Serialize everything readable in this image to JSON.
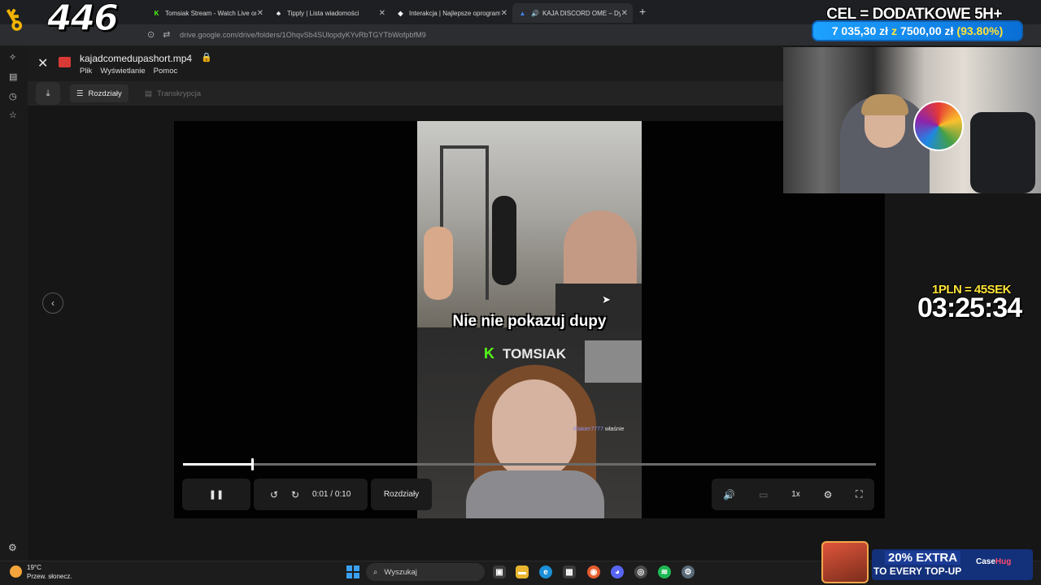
{
  "browser": {
    "tabs": [
      {
        "label": "Tomsiak Stream - Watch Live on",
        "favicon": "kick-icon",
        "color": "#53fc18"
      },
      {
        "label": "Tipply | Lista wiadomości",
        "favicon": "tipply-icon",
        "color": "#ffffff"
      },
      {
        "label": "Interakcja | Najlepsze oprogram",
        "favicon": "diamond-icon",
        "color": "#ffffff"
      },
      {
        "label": "KAJA DISCORD OME – Dysk",
        "favicon": "drive-icon",
        "color": "#4285f4"
      }
    ],
    "url": "drive.google.com/drive/folders/1OhqvSb4SUlopdyKYvRbTGYTbWofpbfM9"
  },
  "overlay": {
    "logo_number": "446",
    "goal_title": "CEL = DODATKOWE 5H+",
    "goal_current": "7 035,30 zł",
    "goal_separator": "z",
    "goal_target": "7500,00 zł",
    "goal_percent": "(93.80%)",
    "timer_rate": "1PLN = 45SEK",
    "timer_value": "03:25:34",
    "promo_extra": "20% EXTRA",
    "promo_topup": "TO EVERY TOP-UP",
    "promo_brand_a": "Case",
    "promo_brand_b": "Hug"
  },
  "viewer": {
    "file_name": "kajadcomedupashort.mp4",
    "menu": [
      "Plik",
      "Wyświetlanie",
      "Pomoc"
    ],
    "chip_chapters": "Rozdziały",
    "chip_transcript": "Transkrypcja"
  },
  "video": {
    "caption": "Nie nie pokazuj dupy",
    "kick_letter": "K",
    "kick_name": "TOMSIAK",
    "chat_user": "Klakier7777",
    "chat_text": "właśnie"
  },
  "player": {
    "current_time": "0:01",
    "separator": "/",
    "duration": "0:10",
    "progress_fraction": 0.1,
    "chapters_label": "Rozdziały",
    "speed": "1x"
  },
  "taskbar": {
    "weather_temp": "19°C",
    "weather_desc": "Przew. słonecz.",
    "search_placeholder": "Wyszukaj"
  }
}
